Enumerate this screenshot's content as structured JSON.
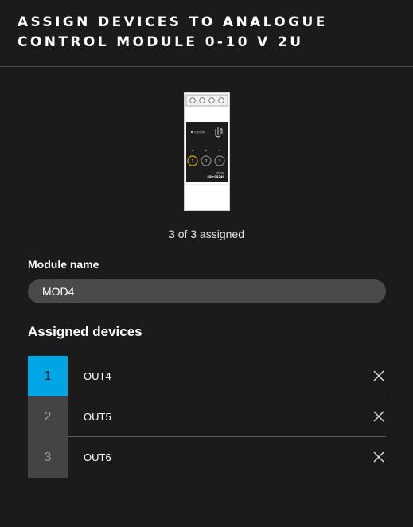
{
  "header": {
    "title": "ASSIGN DEVICES TO ANALOGUE CONTROL MODULE 0-10 V 2U"
  },
  "device_image": {
    "brand": "Vitrum",
    "model": "SS0-0S240",
    "model_top": "vitrum",
    "channels": [
      "1",
      "2",
      "3"
    ]
  },
  "assigned_count": "3 of 3 assigned",
  "module_name": {
    "label": "Module name",
    "value": "MOD4"
  },
  "assigned_devices": {
    "title": "Assigned devices",
    "items": [
      {
        "slot": "1",
        "name": "OUT4",
        "active": true
      },
      {
        "slot": "2",
        "name": "OUT5",
        "active": false
      },
      {
        "slot": "3",
        "name": "OUT6",
        "active": false
      }
    ]
  },
  "colors": {
    "background": "#1b1b1b",
    "accent": "#00a6e4",
    "input_bg": "#4a4a4a",
    "slot_bg": "#444444"
  }
}
